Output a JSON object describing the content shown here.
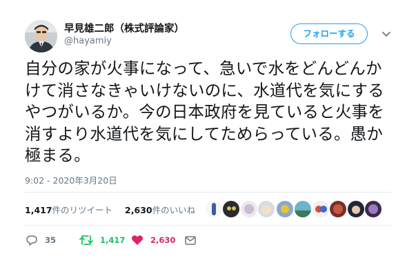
{
  "author": {
    "display_name": "早見雄二郎（株式評論家）",
    "handle": "@hayamiy"
  },
  "follow_button": {
    "label": "フォローする"
  },
  "tweet": {
    "text": "自分の家が火事になって、急いで水をどんどんかけて消さなきゃいけないのに、水道代を気にするやつがいるか。今の日本政府を見ていると火事を消すより水道代を気にしてためらっている。愚か極まる。",
    "timestamp": "9:02 - 2020年3月20日"
  },
  "stats": {
    "retweets_count": "1,417",
    "retweets_label": "件のリツイート",
    "likes_count": "2,630",
    "likes_label": "件のいいね"
  },
  "actions": {
    "replies": "35",
    "retweets": "1,417",
    "likes": "2,630"
  },
  "colors": {
    "accent": "#1da1f2",
    "retweet": "#17bf63",
    "like": "#e0245e",
    "muted": "#657786"
  },
  "icons": {
    "reply": "reply-icon",
    "retweet": "retweet-icon",
    "like": "heart-icon",
    "dm": "envelope-icon",
    "menu": "chevron-down-icon"
  }
}
